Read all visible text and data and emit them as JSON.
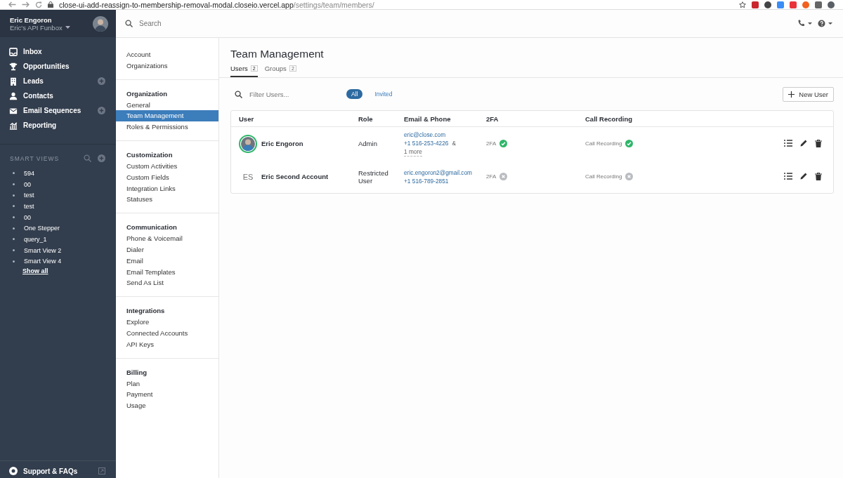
{
  "browser": {
    "url_host": "close-ui-add-reassign-to-membership-removal-modal.closeio.vercel.app",
    "url_path": "/settings/team/members/"
  },
  "account": {
    "name": "Eric Engoron",
    "org": "Eric's API Funbox"
  },
  "search": {
    "placeholder": "Search"
  },
  "nav": [
    {
      "label": "Inbox",
      "has_add": false
    },
    {
      "label": "Opportunities",
      "has_add": false
    },
    {
      "label": "Leads",
      "has_add": true
    },
    {
      "label": "Contacts",
      "has_add": false
    },
    {
      "label": "Email Sequences",
      "has_add": true
    },
    {
      "label": "Reporting",
      "has_add": false
    }
  ],
  "smart_views": {
    "title": "SMART VIEWS",
    "items": [
      "594",
      "00",
      "test",
      "test",
      "00",
      "One Stepper",
      "query_1",
      "Smart View 2",
      "Smart View 4"
    ],
    "show_all": "Show all"
  },
  "support": {
    "label": "Support & FAQs"
  },
  "settings_sections": [
    {
      "items": [
        {
          "label": "Account",
          "selected": false
        },
        {
          "label": "Organizations",
          "selected": false
        }
      ]
    },
    {
      "heading": "Organization",
      "items": [
        {
          "label": "General",
          "selected": false
        },
        {
          "label": "Team Management",
          "selected": true
        },
        {
          "label": "Roles & Permissions",
          "selected": false
        }
      ]
    },
    {
      "heading": "Customization",
      "items": [
        {
          "label": "Custom Activities",
          "selected": false
        },
        {
          "label": "Custom Fields",
          "selected": false
        },
        {
          "label": "Integration Links",
          "selected": false
        },
        {
          "label": "Statuses",
          "selected": false
        }
      ]
    },
    {
      "heading": "Communication",
      "items": [
        {
          "label": "Phone & Voicemail",
          "selected": false
        },
        {
          "label": "Dialer",
          "selected": false
        },
        {
          "label": "Email",
          "selected": false
        },
        {
          "label": "Email Templates",
          "selected": false
        },
        {
          "label": "Send As List",
          "selected": false
        }
      ]
    },
    {
      "heading": "Integrations",
      "items": [
        {
          "label": "Explore",
          "selected": false
        },
        {
          "label": "Connected Accounts",
          "selected": false
        },
        {
          "label": "API Keys",
          "selected": false
        }
      ]
    },
    {
      "heading": "Billing",
      "items": [
        {
          "label": "Plan",
          "selected": false
        },
        {
          "label": "Payment",
          "selected": false
        },
        {
          "label": "Usage",
          "selected": false
        }
      ]
    }
  ],
  "page": {
    "title": "Team Management",
    "tabs": [
      {
        "label": "Users",
        "count": "2",
        "selected": true
      },
      {
        "label": "Groups",
        "count": "2",
        "selected": false
      }
    ],
    "filter": {
      "placeholder": "Filter Users..."
    },
    "filter_buttons": [
      {
        "label": "All",
        "selected": true
      },
      {
        "label": "Invited",
        "selected": false
      }
    ],
    "new_user_button": "New User",
    "columns": [
      "User",
      "Role",
      "Email & Phone",
      "2FA",
      "Call Recording"
    ],
    "rows": [
      {
        "avatar": {
          "kind": "photo"
        },
        "name": "Eric Engoron",
        "role": "Admin",
        "email": "eric@close.com",
        "phone": "+1 516-253-4226",
        "extra_connector": "&",
        "extra": "1 more",
        "twofa": {
          "label": "2FA",
          "enabled": true
        },
        "call_recording": {
          "label": "Call Recording",
          "enabled": true
        }
      },
      {
        "avatar": {
          "kind": "initials",
          "text": "ES"
        },
        "name": "Eric Second Account",
        "role": "Restricted User",
        "email": "eric.engoron2@gmail.com",
        "phone": "+1 516-789-2851",
        "twofa": {
          "label": "2FA",
          "enabled": false
        },
        "call_recording": {
          "label": "Call Recording",
          "enabled": false
        }
      }
    ]
  }
}
